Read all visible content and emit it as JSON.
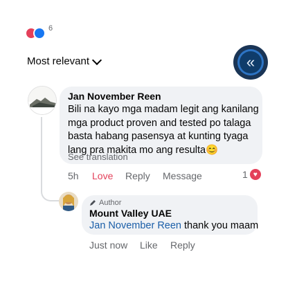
{
  "colors": {
    "accent": "#1877f2",
    "love": "#e4405a",
    "muted": "#65676b",
    "bubble": "#f0f2f5"
  },
  "reactions": {
    "icons": [
      "heart-icon",
      "like-icon"
    ],
    "count": "6"
  },
  "sort": {
    "label": "Most relevant",
    "icon": "chevron-down-icon"
  },
  "fab": {
    "icon": "double-chevron-left-icon",
    "glyph": "«"
  },
  "comment": {
    "author": "Jan November Reen",
    "text": "Bili na kayo mga madam legit ang kanilang mga product proven and tested po talaga basta habang pasensya at kunting tyaga lang pra makita mo ang resulta😊",
    "see_translation": "See translation",
    "time": "5h",
    "love_label": "Love",
    "reply_label": "Reply",
    "message_label": "Message",
    "reaction_count": "1"
  },
  "reply": {
    "badge": "Author",
    "author": "Mount Valley UAE",
    "mention": "Jan November Reen",
    "text": " thank you maam",
    "time": "Just now",
    "like_label": "Like",
    "reply_label": "Reply"
  }
}
